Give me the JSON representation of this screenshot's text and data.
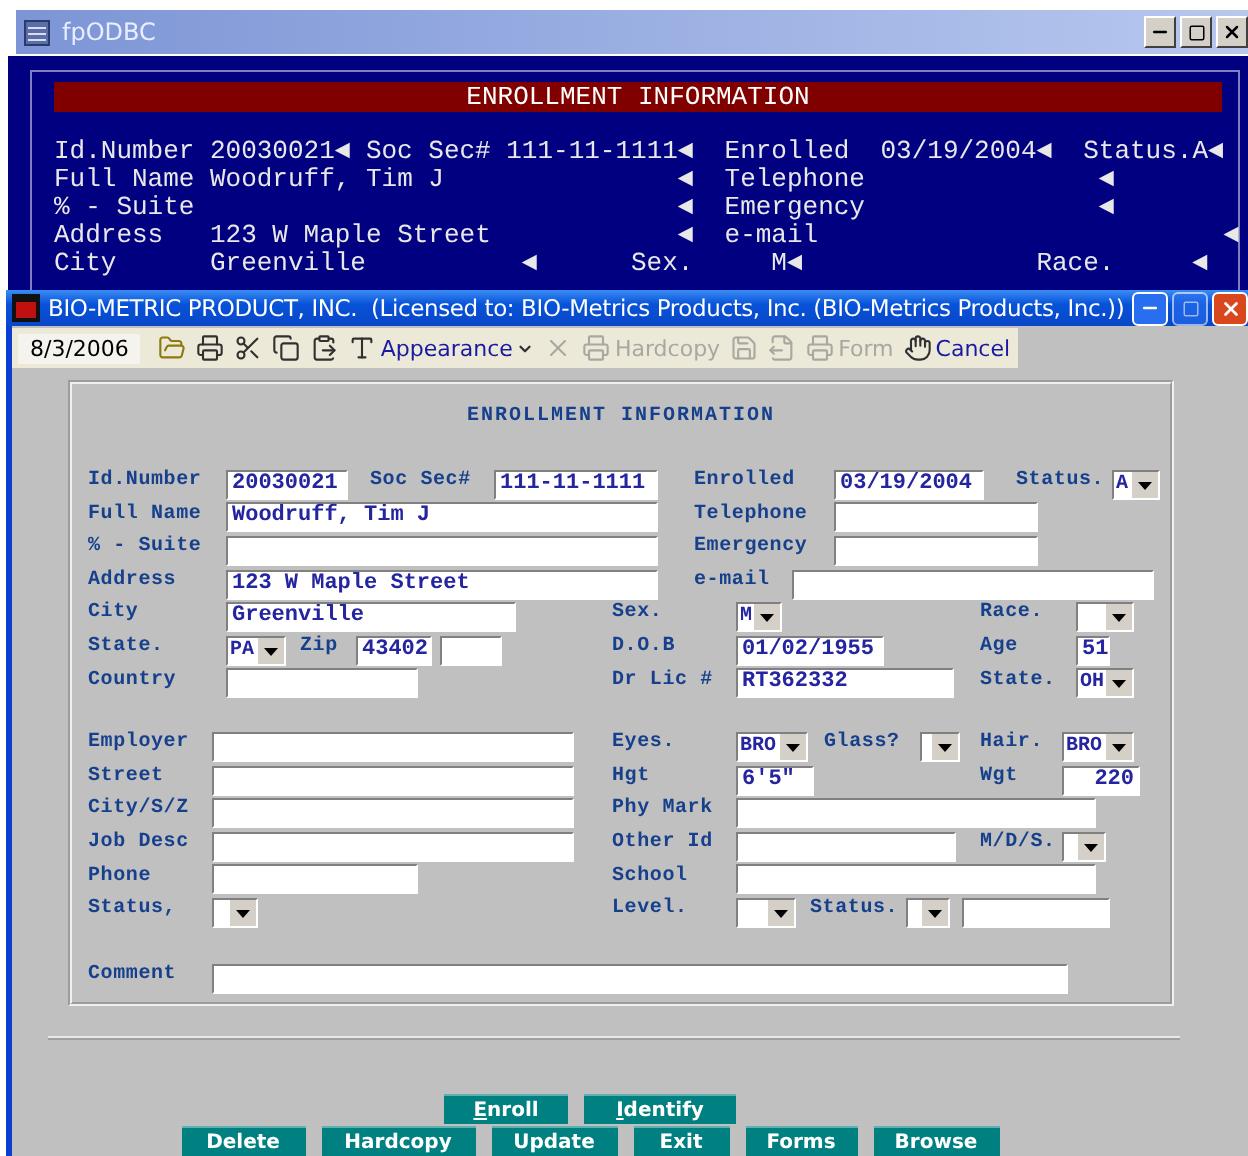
{
  "back_window": {
    "title": "fpODBC"
  },
  "console": {
    "banner": "ENROLLMENT INFORMATION",
    "lines": [
      [
        "Id.Number",
        "20030021◄",
        "Soc Sec#",
        "111-11-1111◄",
        "Enrolled",
        "03/19/2004◄",
        "Status.A◄"
      ],
      [
        "Full Name",
        "Woodruff, Tim J",
        "◄",
        "Telephone",
        "◄"
      ],
      [
        "% - Suite",
        "◄",
        "Emergency",
        "◄"
      ],
      [
        "Address",
        "123 W Maple Street",
        "◄",
        "e-mail",
        "◄"
      ],
      [
        "City",
        "Greenville",
        "◄",
        "Sex.",
        "M◄",
        "Race.",
        "◄"
      ]
    ]
  },
  "window": {
    "title": "BIO-METRIC PRODUCT, INC.  (Licensed to: BIO-Metrics Products, Inc. (BIO-Metrics Products, Inc.))"
  },
  "toolbar": {
    "date": "8/3/2006",
    "items": [
      {
        "kind": "open",
        "disabled": false
      },
      {
        "kind": "print",
        "disabled": false
      },
      {
        "kind": "cut",
        "disabled": false
      },
      {
        "kind": "copy",
        "disabled": false
      },
      {
        "kind": "paste",
        "disabled": false
      },
      {
        "kind": "appearance",
        "label": "Appearance",
        "disabled": false
      },
      {
        "kind": "delete",
        "disabled": true
      },
      {
        "kind": "print",
        "label": "Hardcopy",
        "disabled": true
      },
      {
        "kind": "save",
        "disabled": true
      },
      {
        "kind": "export",
        "disabled": true
      },
      {
        "kind": "print",
        "label": "Form",
        "disabled": true
      },
      {
        "kind": "cancel",
        "label": "Cancel",
        "disabled": false
      }
    ]
  },
  "form": {
    "title": "ENROLLMENT INFORMATION",
    "lines": [
      {
        "fields": [
          {
            "kind": "label",
            "text": "Id.Number"
          },
          {
            "kind": "input",
            "value": "20030021"
          },
          {
            "kind": "label",
            "text": "Soc Sec#"
          },
          {
            "kind": "input",
            "value": "111-11-1111"
          },
          {
            "kind": "label",
            "text": "Enrolled"
          },
          {
            "kind": "input",
            "value": "03/19/2004"
          },
          {
            "kind": "label",
            "text": "Status."
          },
          {
            "kind": "select",
            "value": "A"
          }
        ]
      },
      {
        "fields": [
          {
            "kind": "label",
            "text": "Full Name"
          },
          {
            "kind": "input",
            "value": "Woodruff, Tim J"
          },
          {
            "kind": "label",
            "text": "Telephone"
          },
          {
            "kind": "input"
          }
        ]
      },
      {
        "fields": [
          {
            "kind": "label",
            "text": "% - Suite"
          },
          {
            "kind": "input"
          },
          {
            "kind": "label",
            "text": "Emergency"
          },
          {
            "kind": "input"
          }
        ]
      },
      {
        "fields": [
          {
            "kind": "label",
            "text": "Address"
          },
          {
            "kind": "input",
            "value": "123 W Maple Street"
          },
          {
            "kind": "label",
            "text": "e-mail"
          },
          {
            "kind": "input"
          }
        ]
      },
      {
        "fields": [
          {
            "kind": "label",
            "text": "City"
          },
          {
            "kind": "input",
            "value": "Greenville"
          },
          {
            "kind": "label",
            "text": "Sex."
          },
          {
            "kind": "select",
            "value": "M"
          },
          {
            "kind": "label",
            "text": "Race."
          },
          {
            "kind": "select"
          }
        ]
      },
      {
        "fields": [
          {
            "kind": "label",
            "text": "State."
          },
          {
            "kind": "select",
            "value": "PA"
          },
          {
            "kind": "label",
            "text": "Zip"
          },
          {
            "kind": "input",
            "value": "43402"
          },
          {
            "kind": "input"
          },
          {
            "kind": "label",
            "text": "D.O.B"
          },
          {
            "kind": "input",
            "value": "01/02/1955"
          },
          {
            "kind": "label",
            "text": "Age"
          },
          {
            "kind": "input",
            "value": "51"
          }
        ]
      },
      {
        "fields": [
          {
            "kind": "label",
            "text": "Country"
          },
          {
            "kind": "input"
          },
          {
            "kind": "label",
            "text": "Dr Lic #"
          },
          {
            "kind": "input",
            "value": "RT362332"
          },
          {
            "kind": "label",
            "text": "State."
          },
          {
            "kind": "select",
            "value": "OH"
          }
        ]
      },
      {
        "fields": [
          {
            "kind": "label",
            "text": "Employer"
          },
          {
            "kind": "input"
          },
          {
            "kind": "label",
            "text": "Eyes."
          },
          {
            "kind": "select",
            "value": "BRO"
          },
          {
            "kind": "label",
            "text": "Glass?"
          },
          {
            "kind": "select"
          },
          {
            "kind": "label",
            "text": "Hair."
          },
          {
            "kind": "select",
            "value": "BRO"
          }
        ]
      },
      {
        "fields": [
          {
            "kind": "label",
            "text": "Street"
          },
          {
            "kind": "input"
          },
          {
            "kind": "label",
            "text": "Hgt"
          },
          {
            "kind": "input",
            "value": "6'5\""
          },
          {
            "kind": "label",
            "text": "Wgt"
          },
          {
            "kind": "number",
            "value": "220"
          }
        ]
      },
      {
        "fields": [
          {
            "kind": "label",
            "text": "City/S/Z"
          },
          {
            "kind": "input"
          },
          {
            "kind": "label",
            "text": "Phy Mark"
          },
          {
            "kind": "input"
          }
        ]
      },
      {
        "fields": [
          {
            "kind": "label",
            "text": "Job Desc"
          },
          {
            "kind": "input"
          },
          {
            "kind": "label",
            "text": "Other Id"
          },
          {
            "kind": "input"
          },
          {
            "kind": "label",
            "text": "M/D/S."
          },
          {
            "kind": "select"
          }
        ]
      },
      {
        "fields": [
          {
            "kind": "label",
            "text": "Phone"
          },
          {
            "kind": "input"
          },
          {
            "kind": "label",
            "text": "School"
          },
          {
            "kind": "input"
          }
        ]
      },
      {
        "fields": [
          {
            "kind": "label",
            "text": "Status,"
          },
          {
            "kind": "select"
          },
          {
            "kind": "label",
            "text": "Level."
          },
          {
            "kind": "select"
          },
          {
            "kind": "label",
            "text": "Status."
          },
          {
            "kind": "select"
          },
          {
            "kind": "input"
          }
        ]
      },
      {
        "fields": [
          {
            "kind": "label",
            "text": "Comment"
          },
          {
            "kind": "input"
          }
        ]
      }
    ]
  },
  "buttons": [
    [
      "Enroll",
      "Identify"
    ],
    [
      "Delete",
      "Hardcopy",
      "Update",
      "Exit",
      "Forms",
      "Browse"
    ]
  ]
}
